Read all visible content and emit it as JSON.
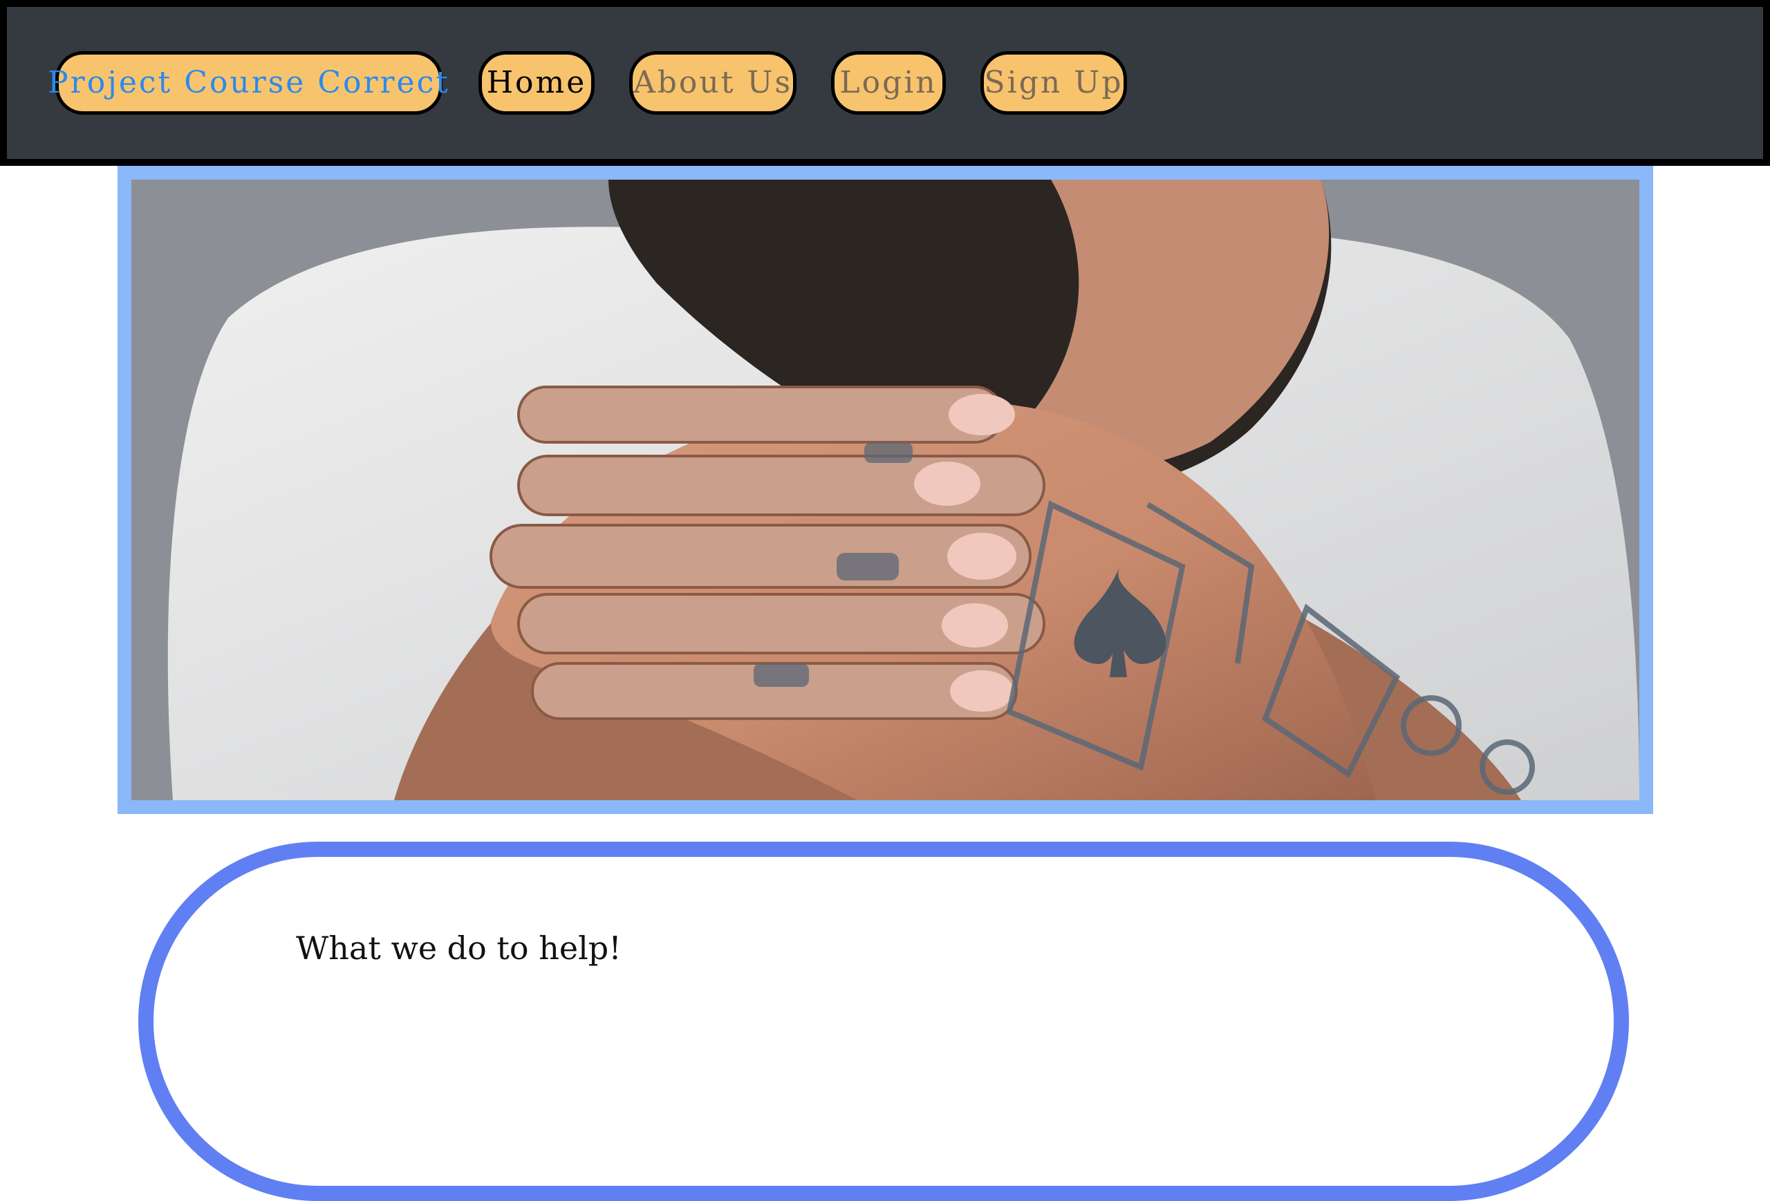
{
  "nav": {
    "brand": "Project Course Correct",
    "links": [
      "Home",
      "About Us",
      "Login",
      "Sign Up"
    ]
  },
  "hero": {
    "image": "man-with-tattooed-clasped-hands"
  },
  "section": {
    "heading": "What we do to help!"
  },
  "colors": {
    "navbar": "#343a40",
    "pill": "#f8c36d",
    "brand_text": "#2a8aee",
    "hero_border": "#8ab8f9",
    "card_border": "#5f7ff3"
  }
}
